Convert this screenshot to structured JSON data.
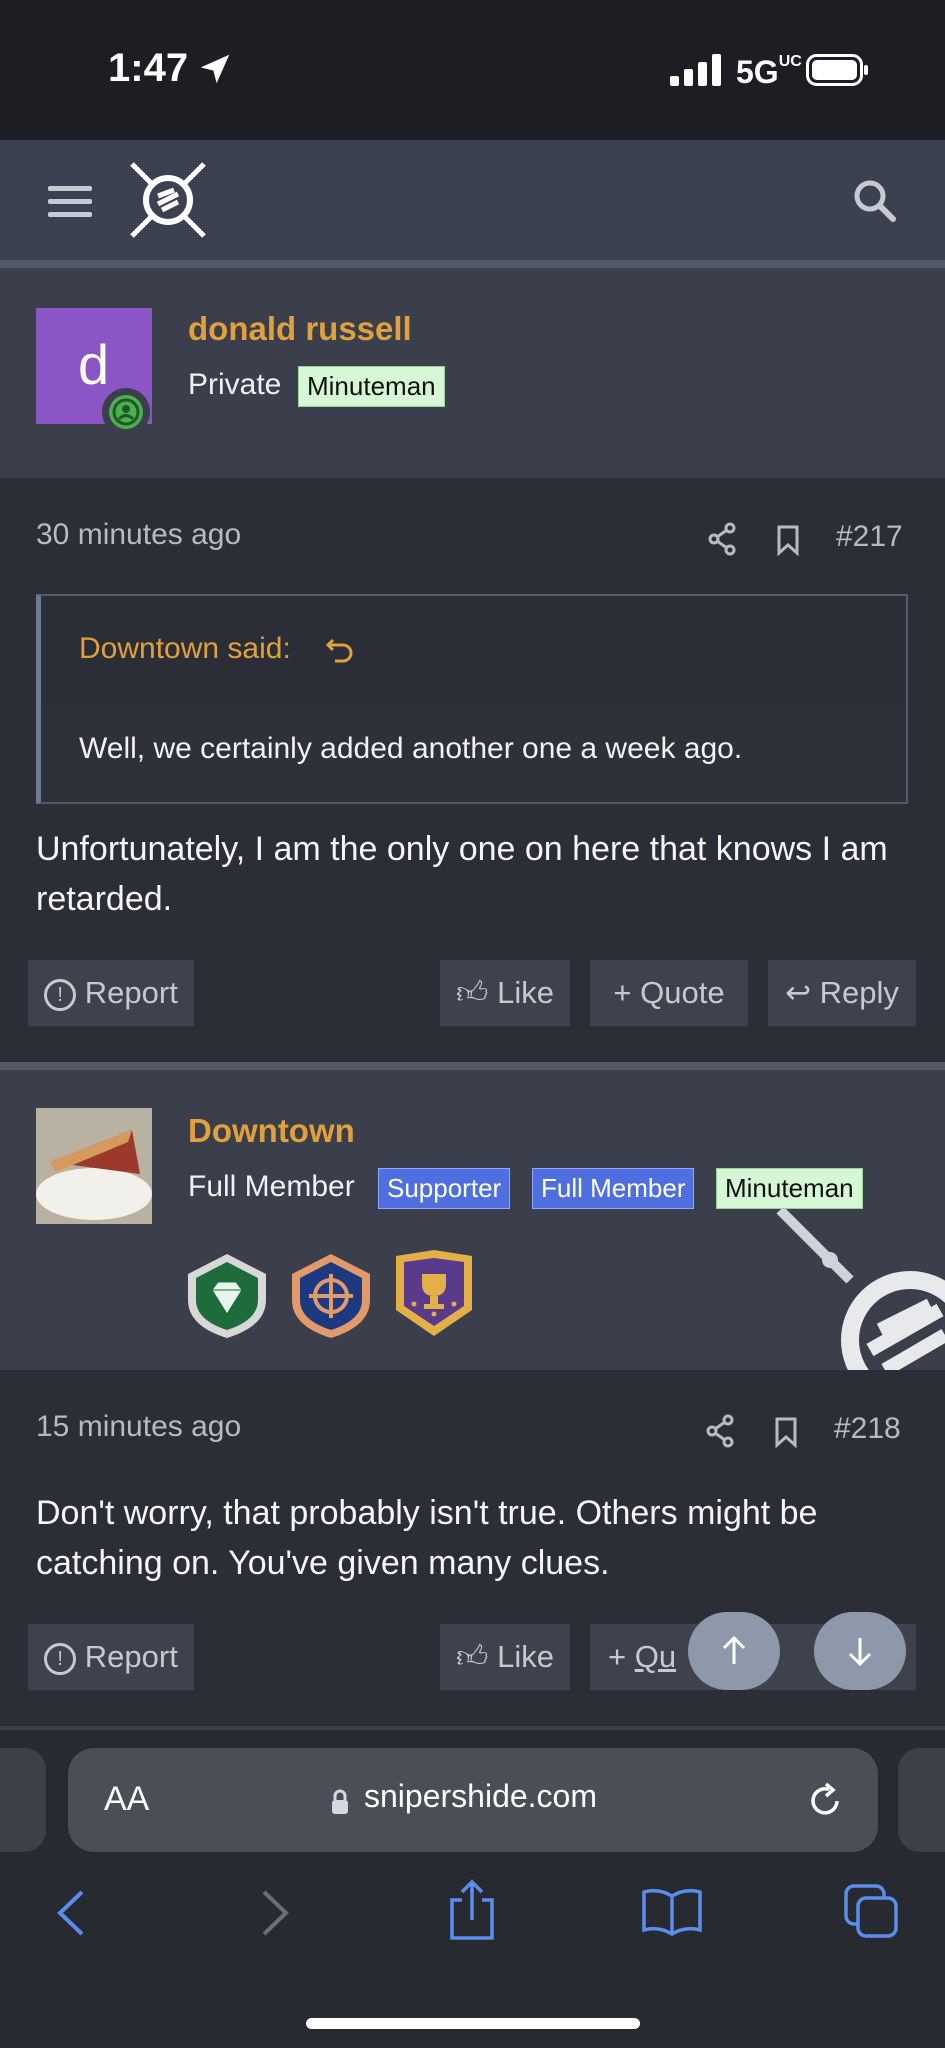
{
  "status_bar": {
    "time": "1:47",
    "network": "5G",
    "network_sup": "UC"
  },
  "site": {
    "name": "snipershide.com"
  },
  "posts": [
    {
      "author": "donald russell",
      "avatar_letter": "d",
      "rank": "Private",
      "badges": [
        "Minuteman"
      ],
      "time": "30 minutes ago",
      "number": "#217",
      "quote": {
        "author": "Downtown said:",
        "text": "Well, we certainly added another one a week ago."
      },
      "body": "Unfortunately, I am the only one on here that knows I am retarded.",
      "actions": {
        "report": "Report",
        "like": "Like",
        "quote": "Quote",
        "reply": "Reply"
      }
    },
    {
      "author": "Downtown",
      "rank": "Full Member",
      "badges": [
        "Supporter",
        "Full Member",
        "Minuteman"
      ],
      "trophies": [
        "diamond-trophy-icon",
        "crosshair-trophy-icon",
        "cup-trophy-icon"
      ],
      "time": "15 minutes ago",
      "number": "#218",
      "body": "Don't worry, that probably isn't true. Others might be catching on. You've given many clues.",
      "actions": {
        "report": "Report",
        "like": "Like",
        "quote": "Qu",
        "reply": ""
      }
    }
  ],
  "safari": {
    "text_size": "AA"
  },
  "colors": {
    "accent": "#e0a03d",
    "badge_green": "#d6f7d6",
    "badge_blue": "#4f6fe0",
    "link_blue": "#5b8def"
  }
}
